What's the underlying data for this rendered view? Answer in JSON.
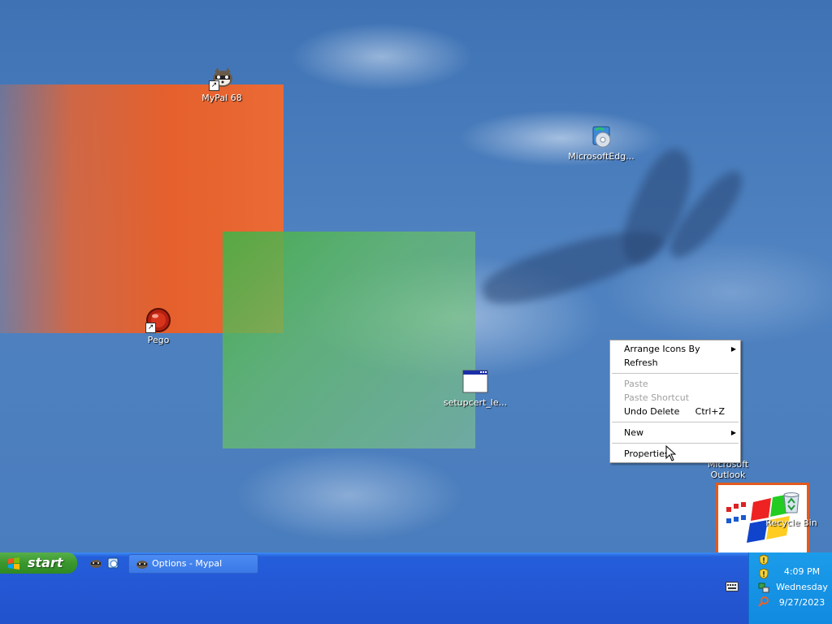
{
  "desktop": {
    "icons": [
      {
        "label": "MyPal 68",
        "icon": "raccoon-icon"
      },
      {
        "label": "MicrosoftEdg...",
        "icon": "edge-installer-icon"
      },
      {
        "label": "Pego",
        "icon": "red-ball-icon"
      },
      {
        "label": "setupcert_le...",
        "icon": "window-icon"
      },
      {
        "label": "Microsoft Outlook",
        "icon": "outlook-icon"
      },
      {
        "label": "Recycle Bin",
        "icon": "recycle-bin-icon"
      }
    ]
  },
  "context_menu": {
    "items": [
      {
        "label": "Arrange Icons By",
        "submenu": true,
        "enabled": true
      },
      {
        "label": "Refresh",
        "enabled": true
      },
      {
        "label": "Paste",
        "enabled": false
      },
      {
        "label": "Paste Shortcut",
        "enabled": false
      },
      {
        "label": "Undo Delete",
        "shortcut": "Ctrl+Z",
        "enabled": true
      },
      {
        "label": "New",
        "submenu": true,
        "enabled": true
      },
      {
        "label": "Properties",
        "enabled": true
      }
    ]
  },
  "taskbar": {
    "start_label": "start",
    "quick_launch": [
      "mypal-icon",
      "edge-icon"
    ],
    "task_button": {
      "label": "Options - Mypal",
      "icon": "mypal-icon"
    },
    "tray": {
      "time": "4:09 PM",
      "day": "Wednesday",
      "date": "9/27/2023",
      "icons": [
        "security-shield-icon",
        "security-shield-icon",
        "network-icon",
        "search-icon"
      ]
    }
  },
  "colors": {
    "taskbar": "#245edb",
    "start_button": "#3a962d",
    "tray": "#1292e4"
  }
}
